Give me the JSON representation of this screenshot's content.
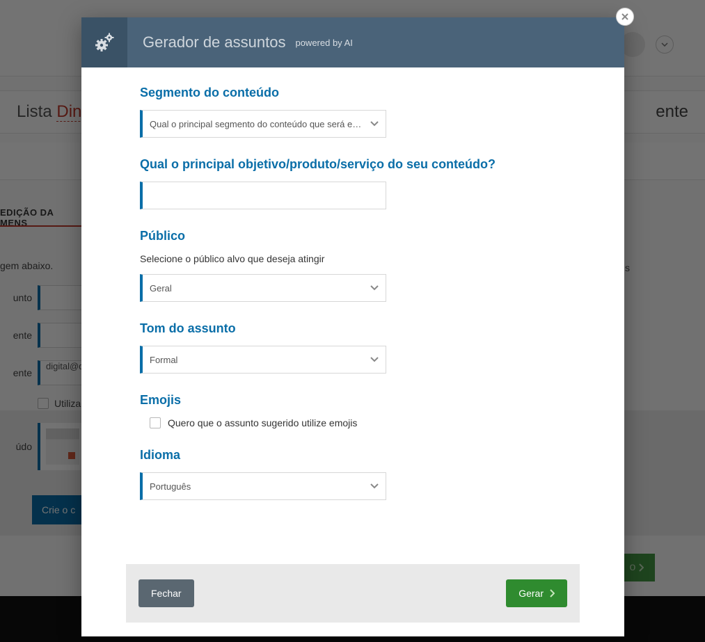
{
  "backdrop": {
    "lista_word1": "Lista",
    "lista_word2": "Dinâ",
    "right_word": "ente",
    "section_title": "EDIÇÃO DA MENS",
    "subtitle_fragment": "gem abaixo.",
    "row_assunto": "unto",
    "row_remetente": "ente",
    "row_email_remetente": "ente",
    "email_value": "digital@di",
    "utilizar": "Utiliza",
    "conteudo_label": "údo",
    "create_btn": "Crie o c",
    "next_btn_label": "o",
    "side_text": "s"
  },
  "modal": {
    "title": "Gerador de assuntos",
    "subtitle": "powered by AI",
    "fields": {
      "segmento": {
        "label": "Segmento do conteúdo",
        "placeholder": "Qual o principal segmento do conteúdo que será envi…"
      },
      "objetivo": {
        "label": "Qual o principal objetivo/produto/serviço do seu conteúdo?",
        "value": ""
      },
      "publico": {
        "label": "Público",
        "desc": "Selecione o público alvo que deseja atingir",
        "value": "Geral"
      },
      "tom": {
        "label": "Tom do assunto",
        "value": "Formal"
      },
      "emojis": {
        "label": "Emojis",
        "checkbox_label": "Quero que o assunto sugerido utilize emojis",
        "checked": false
      },
      "idioma": {
        "label": "Idioma",
        "value": "Português"
      }
    },
    "footer": {
      "close": "Fechar",
      "generate": "Gerar"
    }
  }
}
